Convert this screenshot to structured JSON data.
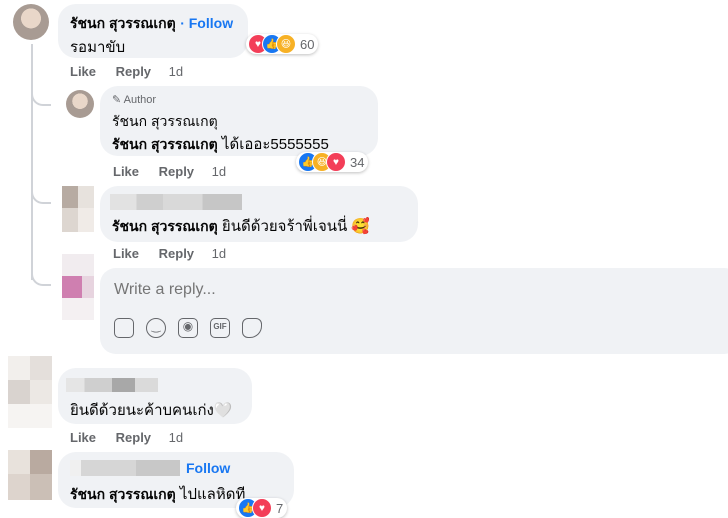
{
  "comments": {
    "c1": {
      "author": "รัชนก สุวรรณเกตุ",
      "follow": "· Follow",
      "text": "รอมาขับ",
      "reaction_count": "60",
      "like": "Like",
      "reply": "Reply",
      "time": "1d"
    },
    "r1": {
      "badge": "Author",
      "name_top": "รัชนก สุวรรณเกตุ",
      "mention": "รัชนก สุวรรณเกตุ",
      "text": " ได้เออะ5555555",
      "reaction_count": "34",
      "like": "Like",
      "reply": "Reply",
      "time": "1d"
    },
    "r2": {
      "mention": "รัชนก สุวรรณเกตุ",
      "text": " ยินดีด้วยจร้าพี่เจนนี่ 🥰",
      "like": "Like",
      "reply": "Reply",
      "time": "1d"
    },
    "reply_box": {
      "placeholder": "Write a reply..."
    },
    "c2": {
      "text": "ยินดีด้วยนะค้าบคนเก่ง🤍",
      "like": "Like",
      "reply": "Reply",
      "time": "1d"
    },
    "c3": {
      "follow": "Follow",
      "mention": "รัชนก สุวรรณเกตุ",
      "text": " ไปแลหิดที",
      "reaction_count": "7"
    }
  },
  "colors": {
    "accent": "#1877f2",
    "bubble": "#f0f2f5",
    "meta": "#65676b"
  }
}
